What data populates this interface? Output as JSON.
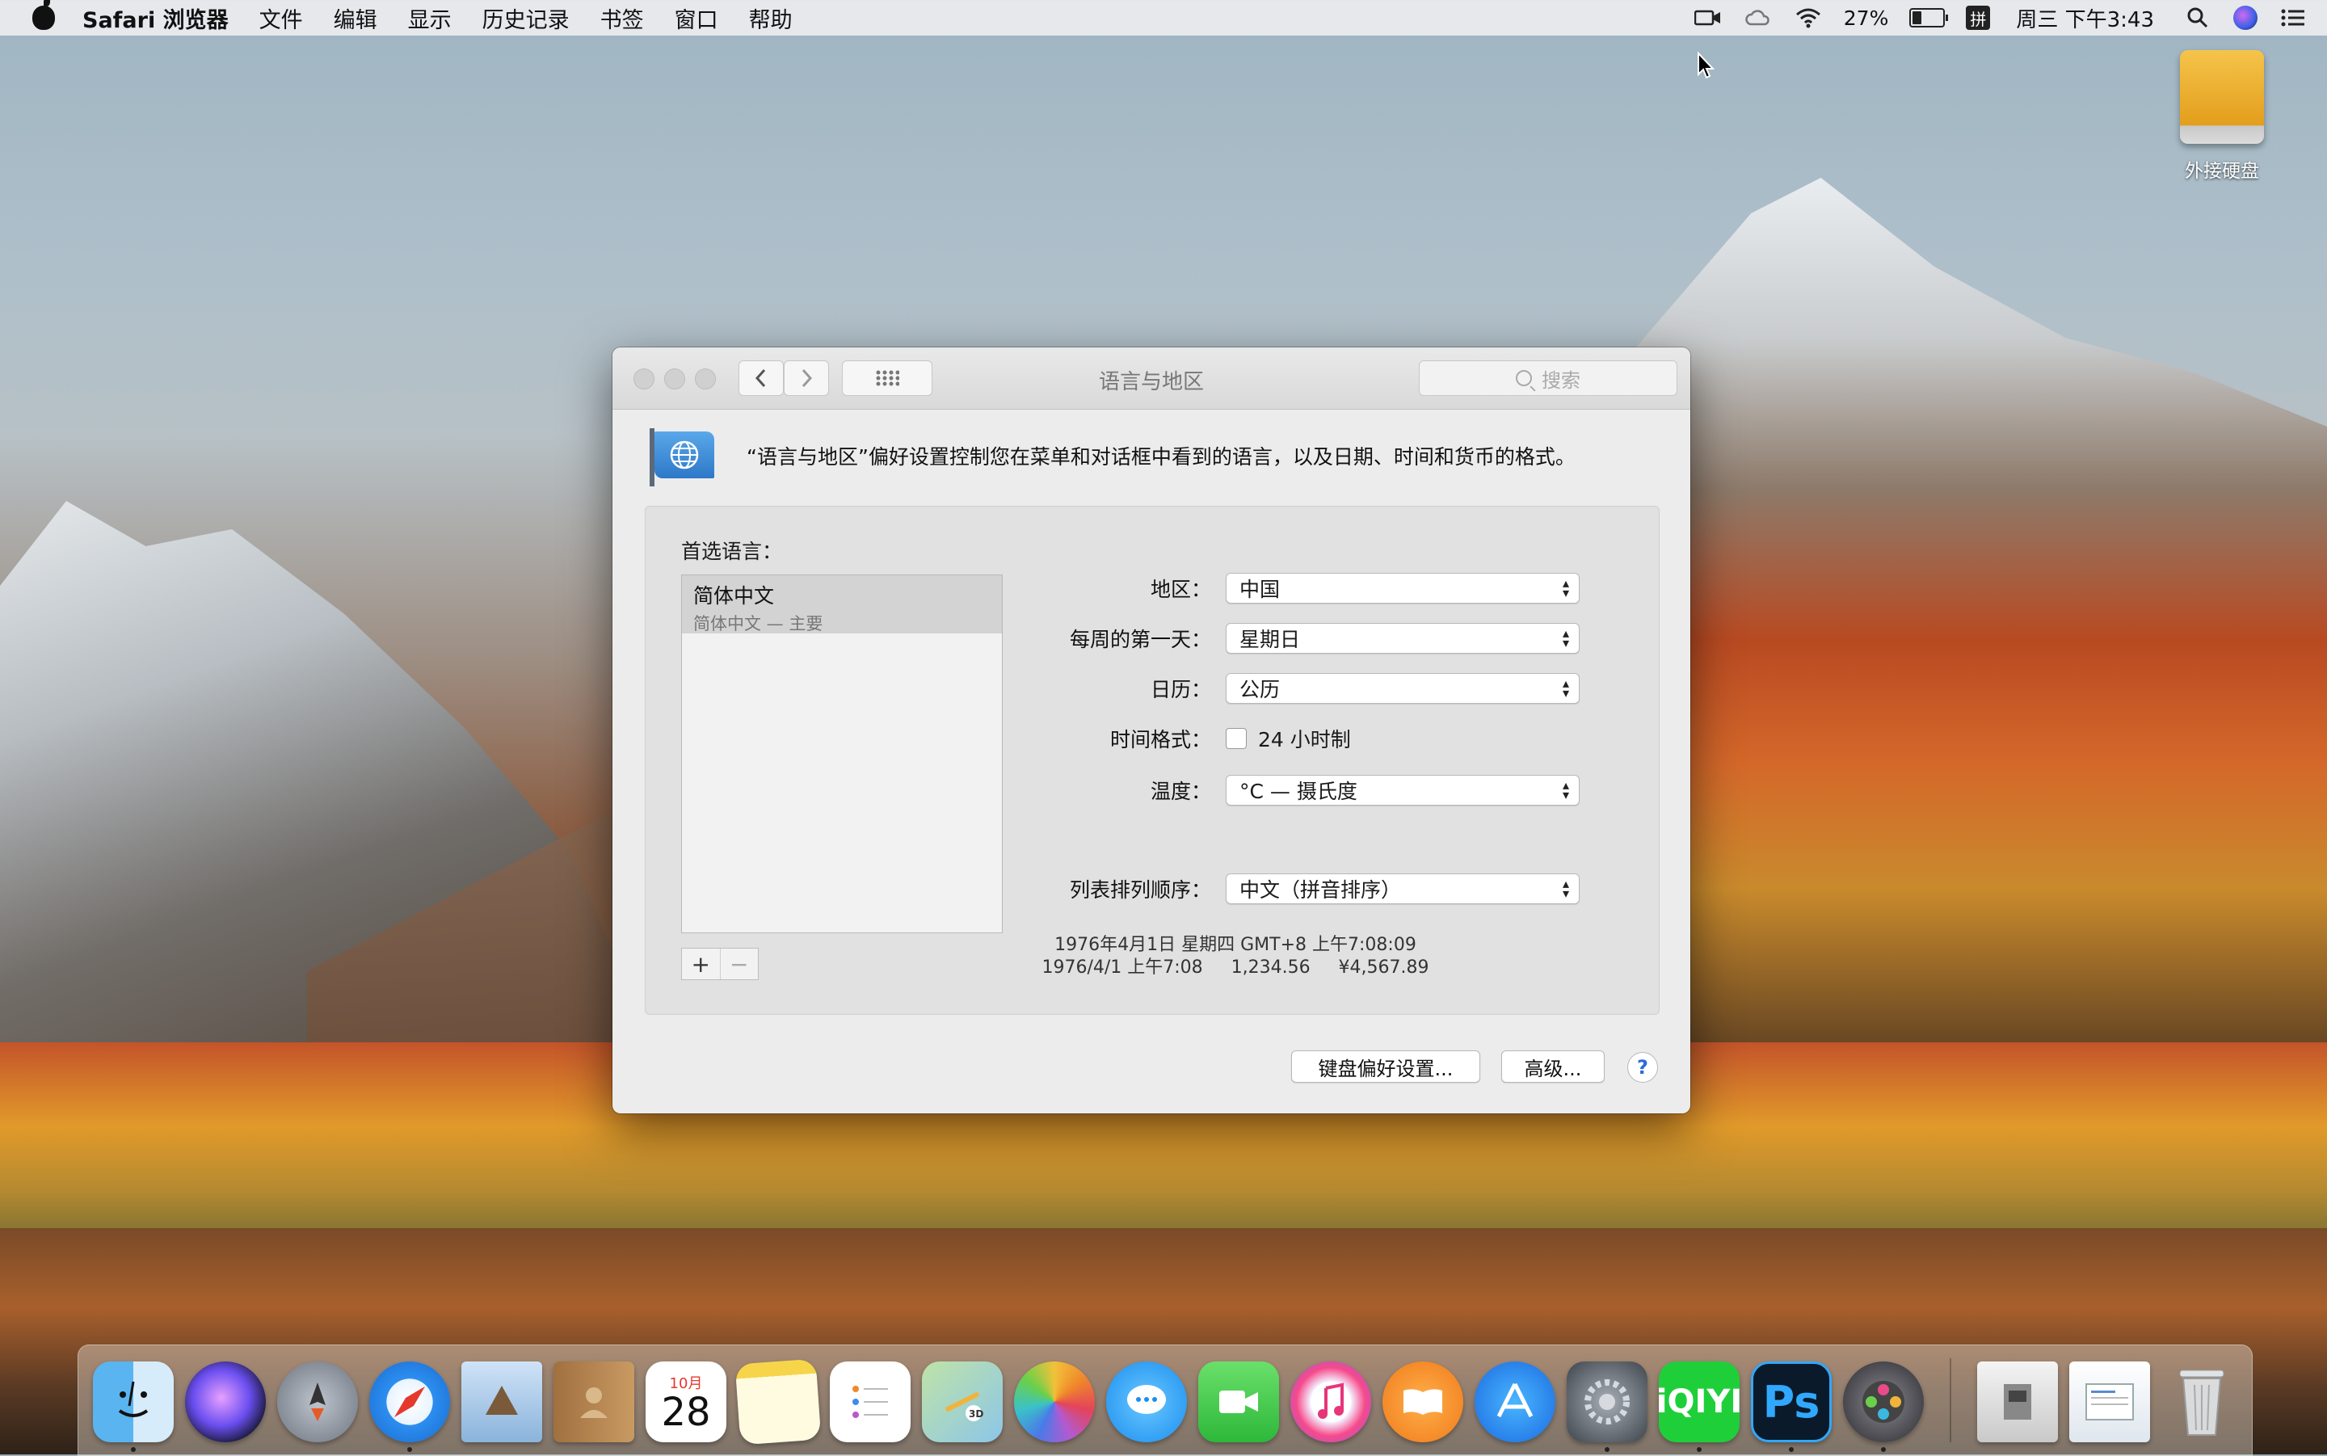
{
  "menubar": {
    "app_name": "Safari 浏览器",
    "items": [
      "文件",
      "编辑",
      "显示",
      "历史记录",
      "书签",
      "窗口",
      "帮助"
    ],
    "battery_percent": "27%",
    "battery_level": 0.27,
    "input_method": "拼",
    "clock": "周三 下午3:43",
    "icons": [
      "apple-icon",
      "camera-icon",
      "creative-cloud-icon",
      "wifi-icon",
      "battery-icon",
      "input-method-icon",
      "spotlight-icon",
      "siri-icon",
      "notification-center-icon"
    ]
  },
  "desktop": {
    "drive_label": "外接硬盘"
  },
  "window": {
    "title": "语言与地区",
    "search_placeholder": "搜索",
    "description": "“语言与地区”偏好设置控制您在菜单和对话框中看到的语言，以及日期、时间和货币的格式。",
    "preferred_languages_label": "首选语言：",
    "languages": [
      {
        "name": "简体中文",
        "sub": "简体中文 — 主要"
      }
    ],
    "add_label": "+",
    "remove_label": "−",
    "settings": {
      "region_label": "地区：",
      "region_value": "中国",
      "first_day_label": "每周的第一天：",
      "first_day_value": "星期日",
      "calendar_label": "日历：",
      "calendar_value": "公历",
      "time_format_label": "时间格式：",
      "time_format_value": "24 小时制",
      "temperature_label": "温度：",
      "temperature_value": "°C — 摄氏度",
      "sort_order_label": "列表排列顺序：",
      "sort_order_value": "中文（拼音排序）"
    },
    "sample_line1": "1976年4月1日 星期四 GMT+8 上午7:08:09",
    "sample_line2": "1976/4/1 上午7:08     1,234.56     ¥4,567.89",
    "keyboard_button": "键盘偏好设置...",
    "advanced_button": "高级...",
    "help_button": "?"
  },
  "dock": {
    "calendar_month": "10月",
    "calendar_day": "28",
    "apps": [
      "finder",
      "siri",
      "launchpad",
      "safari",
      "mail",
      "contacts",
      "calendar",
      "notes",
      "reminders",
      "maps",
      "photos",
      "messages",
      "facetime",
      "itunes",
      "ibooks",
      "app-store",
      "system-preferences",
      "iqiyi",
      "photoshop",
      "photo-slideshow",
      "downloads",
      "documents",
      "trash"
    ]
  }
}
